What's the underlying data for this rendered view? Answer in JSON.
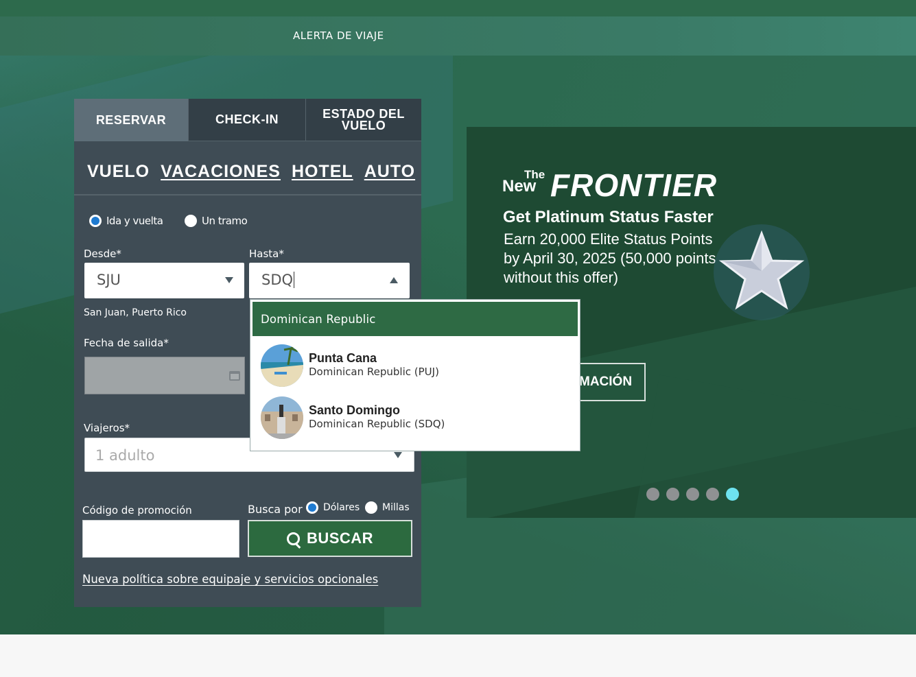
{
  "alert": {
    "text": "ALERTA DE VIAJE"
  },
  "tabs": [
    "RESERVAR",
    "CHECK-IN",
    "ESTADO DEL VUELO"
  ],
  "modes": [
    "VUELO",
    "VACACIONES",
    "HOTEL",
    "AUTO"
  ],
  "trip_type": {
    "round": "Ida y vuelta",
    "oneway": "Un tramo",
    "selected": "Ida y vuelta"
  },
  "from": {
    "label": "Desde*",
    "value": "SJU",
    "sub": "San Juan, Puerto Rico"
  },
  "to": {
    "label": "Hasta*",
    "value": "SDQ"
  },
  "departure": {
    "label": "Fecha de salida*"
  },
  "travelers": {
    "label": "Viajeros*",
    "value": "1 adulto"
  },
  "promo_code": {
    "label": "Código de promoción",
    "value": ""
  },
  "search_by": {
    "label": "Busca por",
    "dollars": "Dólares",
    "miles": "Millas",
    "selected": "Dólares"
  },
  "search_button": "BUSCAR",
  "policy_link": "Nueva política sobre equipaje y servicios opcionales",
  "dropdown": {
    "header": "Dominican Republic",
    "items": [
      {
        "name": "Punta Cana",
        "sub": "Dominican Republic (PUJ)"
      },
      {
        "name": "Santo Domingo",
        "sub": "Dominican Republic (SDQ)"
      }
    ]
  },
  "promo": {
    "logo_the": "The",
    "logo_new": "New",
    "logo_brand": "FRONTIER",
    "headline": "Get Platinum Status Faster",
    "body": "Earn 20,000 Elite Status Points by April 30, 2025 (50,000 points without this offer)",
    "cta": "MACIÓN",
    "slides_total": 5,
    "active_slide": 5
  },
  "colors": {
    "brand_green": "#2c6a3f",
    "panel": "#3f4c55",
    "active_dot": "#6ee3f0"
  }
}
